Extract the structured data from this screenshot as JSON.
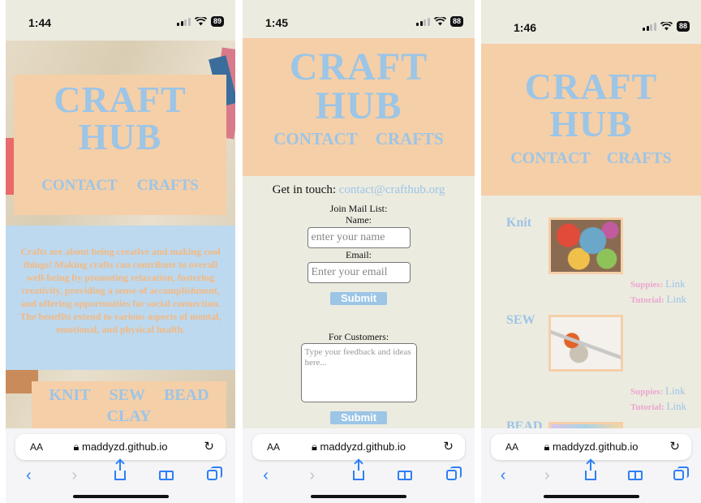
{
  "screens": [
    {
      "time": "1:44",
      "battery": "89",
      "brand": {
        "line1": "CRAFT",
        "line2": "HUB"
      },
      "nav": {
        "contact": "CONTACT",
        "crafts": "CRAFTS"
      },
      "about": "Crafts are about being creative and making cool things! Making crafts can contribute to overall well-being by promoting relaxation, fostering creativity, providing a sense of accomplishment, and offering opportunities for social connection. The benefits extend to various aspects of mental, emotional, and physical health.",
      "categories": [
        "KNIT",
        "SEW",
        "BEAD",
        "CLAY"
      ],
      "url": "maddyzd.github.io"
    },
    {
      "time": "1:45",
      "battery": "88",
      "brand": {
        "line1": "CRAFT",
        "line2": "HUB"
      },
      "nav": {
        "contact": "CONTACT",
        "crafts": "CRAFTS"
      },
      "contact": {
        "get_in_touch": "Get in touch:",
        "email": "contact@crafthub.org",
        "join_label": "Join Mail List:",
        "name_label": "Name:",
        "name_placeholder": "enter your name",
        "email_label": "Email:",
        "email_placeholder": "Enter your email",
        "submit": "Submit",
        "customers_label": "For Customers:",
        "feedback_placeholder": "Type your feedback and ideas here...",
        "submit2": "Submit"
      },
      "url": "maddyzd.github.io"
    },
    {
      "time": "1:46",
      "battery": "88",
      "brand": {
        "line1": "CRAFT",
        "line2": "HUB"
      },
      "nav": {
        "contact": "CONTACT",
        "crafts": "CRAFTS"
      },
      "crafts": [
        {
          "name": "Knit",
          "supplies_label": "Suppies:",
          "supplies_link": "Link",
          "tutorial_label": "Tutorial:",
          "tutorial_link": "Link"
        },
        {
          "name": "SEW",
          "supplies_label": "Suppies:",
          "supplies_link": "Link",
          "tutorial_label": "Tutorial:",
          "tutorial_link": "Link"
        },
        {
          "name": "BEAD"
        }
      ],
      "url": "maddyzd.github.io"
    }
  ],
  "browser": {
    "text_size": "AA"
  },
  "colors": {
    "peach": "#f5cfa8",
    "sky": "#9cc5e6",
    "cream": "#ecebe0",
    "pink": "#e9a6cf"
  }
}
